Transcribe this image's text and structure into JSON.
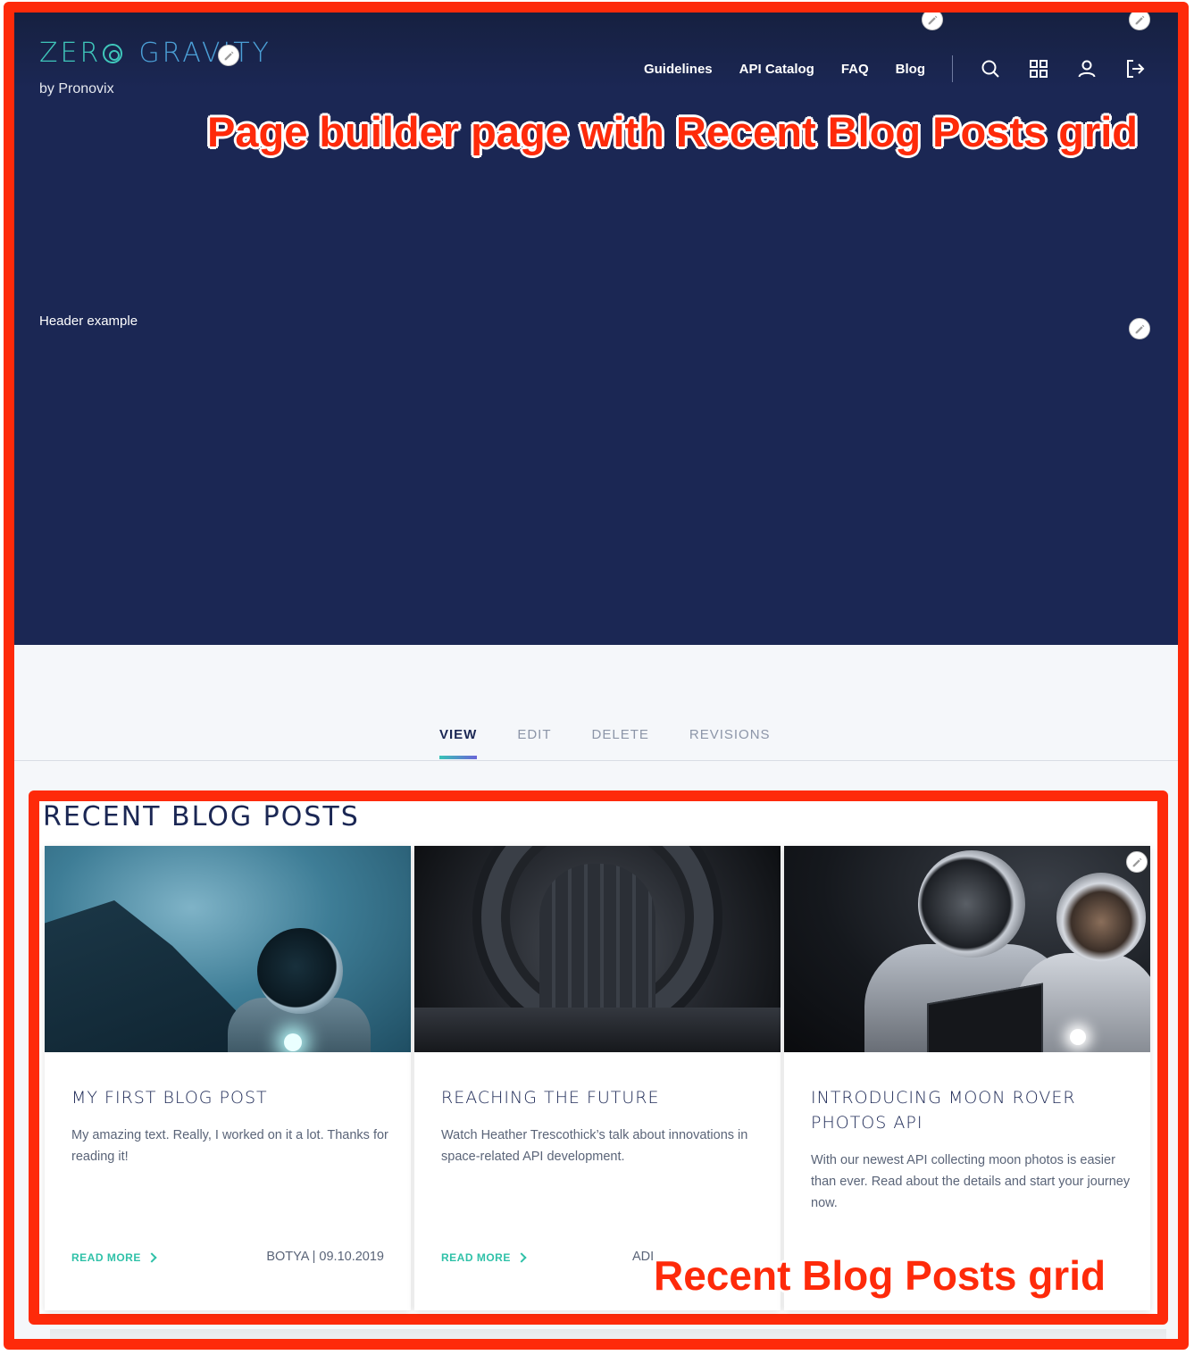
{
  "header": {
    "logo_main_left": "ZER",
    "logo_main_right": "GRAVITY",
    "logo_sub": "by Pronovix",
    "nav_links": [
      "Guidelines",
      "API Catalog",
      "FAQ",
      "Blog"
    ],
    "nav_icons": [
      "search-icon",
      "apps-grid-icon",
      "user-icon",
      "logout-icon"
    ]
  },
  "hero": {
    "text": "Header example"
  },
  "annotations": {
    "page_label": "Page builder page with Recent Blog Posts grid",
    "grid_label": "Recent Blog Posts grid"
  },
  "tabs": [
    {
      "label": "VIEW",
      "active": true
    },
    {
      "label": "EDIT",
      "active": false
    },
    {
      "label": "DELETE",
      "active": false
    },
    {
      "label": "REVISIONS",
      "active": false
    }
  ],
  "blog": {
    "title": "RECENT BLOG POSTS",
    "read_more_label": "READ MORE",
    "cards": [
      {
        "title": "MY FIRST BLOG POST",
        "text": "My amazing text. Really, I worked on it a lot. Thanks for reading it!",
        "author": "BOTYA",
        "separator": " | ",
        "date": "09.10.2019"
      },
      {
        "title": "REACHING THE FUTURE",
        "text": "Watch Heather Trescothick’s talk about innovations in space-related API development.",
        "author": "ADI"
      },
      {
        "title": "INTRODUCING MOON ROVER PHOTOS API",
        "text": "With our newest API collecting moon photos is easier than ever. Read about the details and start your journey now."
      }
    ]
  },
  "colors": {
    "annotation_red": "#fe2a0a",
    "hero_navy": "#1b2754",
    "accent_teal": "#2fc1a8"
  }
}
